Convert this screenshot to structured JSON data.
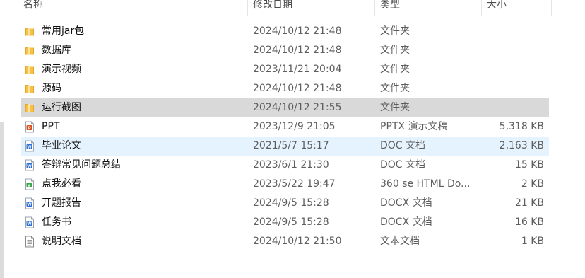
{
  "columns": {
    "name": "名称",
    "date": "修改日期",
    "type": "类型",
    "size": "大小"
  },
  "files": [
    {
      "name": "常用jar包",
      "date": "2024/10/12 21:48",
      "type": "文件夹",
      "size": "",
      "icon": "folder-icon",
      "state": "normal"
    },
    {
      "name": "数据库",
      "date": "2024/10/12 21:48",
      "type": "文件夹",
      "size": "",
      "icon": "folder-icon",
      "state": "normal"
    },
    {
      "name": "演示视频",
      "date": "2023/11/21 20:04",
      "type": "文件夹",
      "size": "",
      "icon": "folder-icon",
      "state": "normal"
    },
    {
      "name": "源码",
      "date": "2024/10/12 21:48",
      "type": "文件夹",
      "size": "",
      "icon": "folder-icon",
      "state": "normal"
    },
    {
      "name": "运行截图",
      "date": "2024/10/12 21:55",
      "type": "文件夹",
      "size": "",
      "icon": "folder-icon",
      "state": "selected"
    },
    {
      "name": "PPT",
      "date": "2023/12/9 21:05",
      "type": "PPTX 演示文稿",
      "size": "5,318 KB",
      "icon": "pptx-icon",
      "state": "normal"
    },
    {
      "name": "毕业论文",
      "date": "2021/5/7 15:17",
      "type": "DOC 文档",
      "size": "2,163 KB",
      "icon": "doc-icon",
      "state": "hover"
    },
    {
      "name": "答辩常见问题总结",
      "date": "2023/6/1 21:30",
      "type": "DOC 文档",
      "size": "15 KB",
      "icon": "doc-icon",
      "state": "normal"
    },
    {
      "name": "点我必看",
      "date": "2023/5/22 19:47",
      "type": "360 se HTML Do...",
      "size": "2 KB",
      "icon": "html-icon",
      "state": "normal"
    },
    {
      "name": "开题报告",
      "date": "2024/9/5 15:28",
      "type": "DOCX 文档",
      "size": "21 KB",
      "icon": "docx-icon",
      "state": "normal"
    },
    {
      "name": "任务书",
      "date": "2024/9/5 15:28",
      "type": "DOCX 文档",
      "size": "16 KB",
      "icon": "docx-icon",
      "state": "normal"
    },
    {
      "name": "说明文档",
      "date": "2024/10/12 21:50",
      "type": "文本文档",
      "size": "1 KB",
      "icon": "txt-icon",
      "state": "normal"
    }
  ],
  "colors": {
    "selected_row": "#d9d9d9",
    "hover_row": "#e5f3ff",
    "folder": "#f8c145",
    "word": "#2b6fd6",
    "ppt": "#d9541e",
    "html": "#36a84a"
  }
}
